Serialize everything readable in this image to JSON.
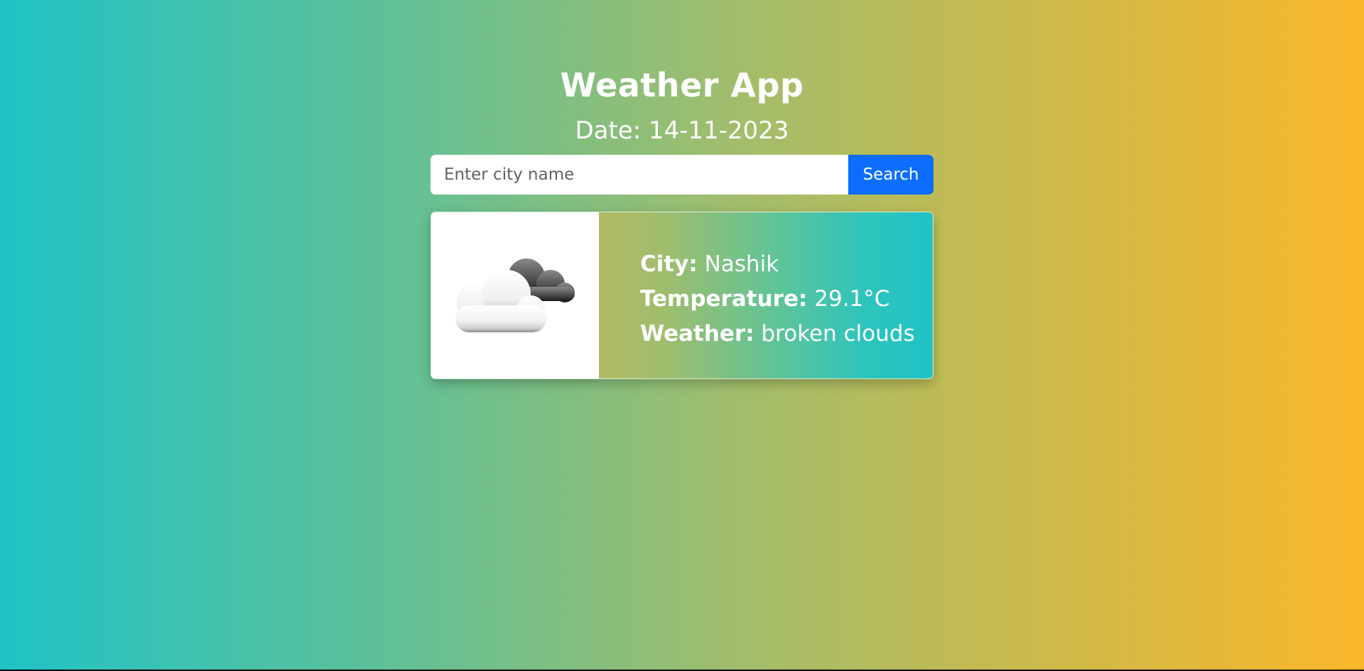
{
  "app": {
    "title": "Weather App",
    "date_text": "Date: 14-11-2023"
  },
  "search": {
    "placeholder": "Enter city name",
    "value": "",
    "button_label": "Search"
  },
  "weather": {
    "icon": "broken-clouds-icon",
    "city_label": "City:",
    "city_value": "Nashik",
    "temperature_label": "Temperature:",
    "temperature_value": "29.1°C",
    "condition_label": "Weather:",
    "condition_value": "broken clouds"
  },
  "colors": {
    "gradient_start": "#20c3c6",
    "gradient_end": "#fbb72b",
    "button": "#0d6efd",
    "text": "#ffffff"
  }
}
